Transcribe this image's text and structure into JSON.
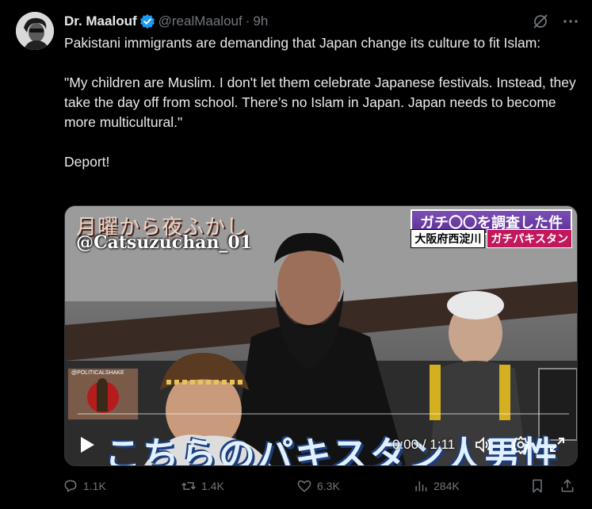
{
  "author": {
    "name": "Dr. Maalouf",
    "handle": "@realMaalouf",
    "separator": "·",
    "time": "9h",
    "verified_color": "#1d9bf0"
  },
  "tweet": {
    "line1": "Pakistani immigrants are demanding that Japan change its culture to fit Islam:",
    "quote": "\"My children are Muslim. I don't let them celebrate Japanese festivals. Instead, they take the day off from school. There’s no Islam in Japan. Japan needs to become more multicultural.\"",
    "closing": "Deport!"
  },
  "media": {
    "show_title": "月曜から夜ふかし",
    "handle_overlay": "@Catsuzuchan_01",
    "tag_top": "ガチ〇〇を調査した件",
    "tag_location": "大阪府西淀川",
    "tag_keyword": "ガチパキスタン",
    "inset_label": "@POLITICALSHAKE",
    "subtitle": "こちらのパキスタン人男性",
    "time_current": "0:00",
    "time_separator": "/",
    "time_total": "1:11",
    "progress": 0
  },
  "actions": {
    "replies": "1.1K",
    "reposts": "1.4K",
    "likes": "6.3K",
    "views": "284K"
  },
  "icons": {
    "verified": "verified-badge-icon",
    "grok": "grok-icon",
    "more": "more-icon",
    "reply": "reply-icon",
    "repost": "repost-icon",
    "like": "heart-icon",
    "views": "views-icon",
    "bookmark": "bookmark-icon",
    "share": "share-icon",
    "play": "play-icon",
    "volume": "volume-icon",
    "settings": "gear-icon",
    "fullscreen": "fullscreen-icon"
  },
  "colors": {
    "background": "#000000",
    "text": "#e7e9ea",
    "muted": "#71767b",
    "accent": "#1d9bf0"
  }
}
